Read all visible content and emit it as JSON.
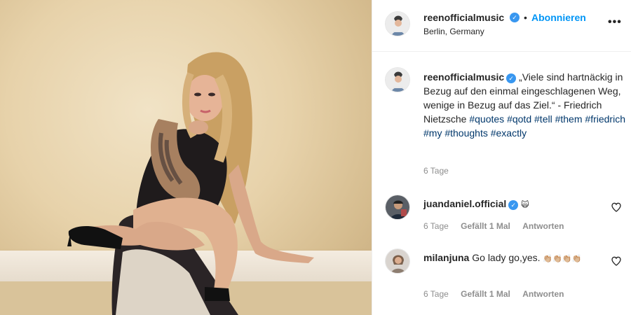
{
  "post": {
    "username": "reenofficialmusic",
    "verified_glyph": "✓",
    "separator": "•",
    "follow_label": "Abonnieren",
    "location": "Berlin, Germany",
    "more_label": "•••"
  },
  "caption": {
    "username": "reenofficialmusic",
    "text": "„Viele sind hartnäckig in Bezug auf den einmal eingeschlagenen Weg, wenige in Bezug auf das Ziel.“ - Friedrich Nietzsche",
    "hashtags": [
      "#quotes",
      "#qotd",
      "#tell",
      "#them",
      "#friedrich",
      "#my",
      "#thoughts",
      "#exactly"
    ],
    "time": "6 Tage"
  },
  "comments": [
    {
      "username": "juandaniel.official",
      "text": "",
      "emoji": "🙀",
      "time": "6 Tage",
      "likes": "Gefällt 1 Mal",
      "reply": "Antworten"
    },
    {
      "username": "milanjuna",
      "text": "Go lady go,yes.",
      "emoji": "👏🏼👏🏼👏🏼👏🏼",
      "time": "6 Tage",
      "likes": "Gefällt 1 Mal",
      "reply": "Antworten"
    }
  ],
  "icons": {
    "verified": "verified-badge-icon",
    "heart": "heart-outline-icon",
    "more": "more-options-icon"
  },
  "colors": {
    "link_blue": "#0095f6",
    "hashtag": "#00376b",
    "verified": "#3897f0",
    "muted": "#8e8e8e"
  }
}
